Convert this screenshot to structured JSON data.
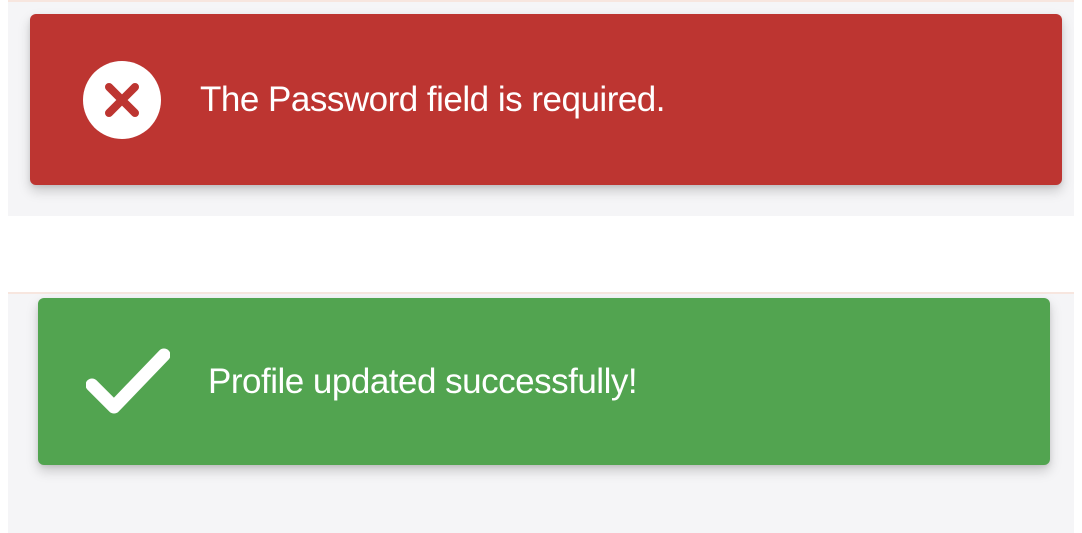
{
  "error_toast": {
    "message": "The Password field is required.",
    "icon": "close-circle-icon",
    "color": "#bd3531"
  },
  "success_toast": {
    "message": "Profile updated successfully!",
    "icon": "checkmark-icon",
    "color": "#52a450"
  }
}
